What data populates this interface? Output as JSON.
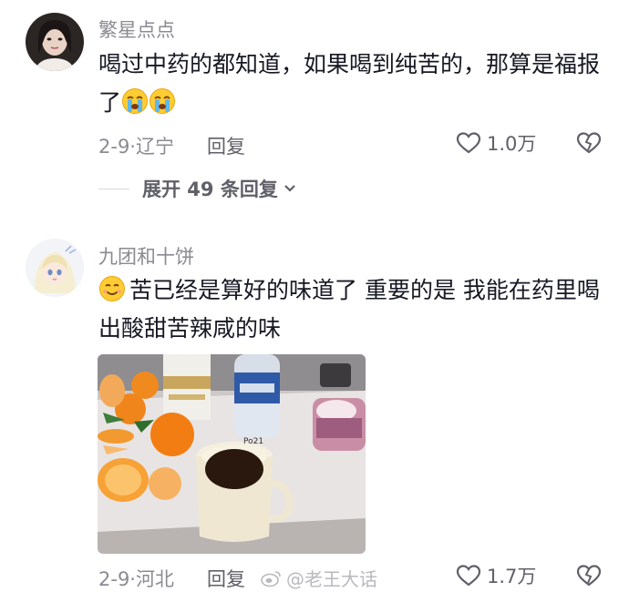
{
  "comments": [
    {
      "username": "繁星点点",
      "text": "喝过中药的都知道，如果喝到纯苦的，那算是福报了",
      "emoji_after": [
        "loudly-crying-face",
        "loudly-crying-face"
      ],
      "date_location": "2-9·辽宁",
      "reply_label": "回复",
      "like_count": "1.0万",
      "expand_label": "展开 49 条回复"
    },
    {
      "username": "九团和十饼",
      "emoji_before": "smiling-face",
      "text": "苦已经是算好的味道了 重要的是 我能在药里喝出酸甜苦辣咸的味",
      "date_location": "2-9·河北",
      "reply_label": "回复",
      "like_count": "1.7万"
    }
  ],
  "watermark": "@老王大话"
}
